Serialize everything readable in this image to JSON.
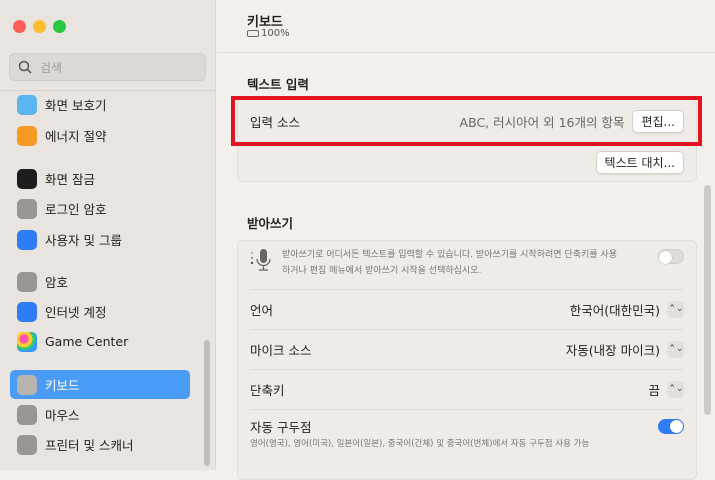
{
  "sidebar": {
    "search_placeholder": "검색",
    "items": [
      {
        "label": "화면 보호기",
        "icon": "screensaver-icon",
        "color": "#5bb5f0"
      },
      {
        "label": "에너지 절약",
        "icon": "lightbulb-icon",
        "color": "#f59a25"
      },
      {
        "label": "화면 잠금",
        "icon": "lock-screen-icon",
        "color": "#1c1c1c"
      },
      {
        "label": "로그인 암호",
        "icon": "lock-icon",
        "color": "#9a9592"
      },
      {
        "label": "사용자 및 그룹",
        "icon": "users-icon",
        "color": "#2f7cf6"
      },
      {
        "label": "암호",
        "icon": "key-icon",
        "color": "#9a9592"
      },
      {
        "label": "인터넷 계정",
        "icon": "at-icon",
        "color": "#2f7cf6"
      },
      {
        "label": "Game Center",
        "icon": "game-center-icon",
        "color": "#ffffff"
      },
      {
        "label": "키보드",
        "icon": "keyboard-icon",
        "color": "#b8b3af"
      },
      {
        "label": "마우스",
        "icon": "mouse-icon",
        "color": "#9a9592"
      },
      {
        "label": "프린터 및 스캐너",
        "icon": "printer-icon",
        "color": "#9a9592"
      }
    ],
    "selected": "키보드"
  },
  "header": {
    "title": "키보드",
    "battery": "100%"
  },
  "text_input": {
    "title": "텍스트 입력",
    "input_source_label": "입력 소스",
    "input_source_value": "ABC, 러시아어 외 16개의 항목",
    "edit_button": "편집...",
    "replace_button": "텍스트 대치..."
  },
  "dictation": {
    "title": "받아쓰기",
    "description": "받아쓰기로 어디서든 텍스트를 입력할 수 있습니다. 받아쓰기를 시작하려면 단축키를 사용하거나 편집 메뉴에서 받아쓰기 시작을 선택하십시오.",
    "enabled": false,
    "language_label": "언어",
    "language_value": "한국어(대한민국)",
    "mic_label": "마이크 소스",
    "mic_value": "자동(내장 마이크)",
    "shortcut_label": "단축키",
    "shortcut_value": "끔",
    "punct_label": "자동 구두점",
    "punct_desc": "영어(영국), 영어(미국), 일본어(일본), 중국어(간체) 및 중국어(번체)에서 자동 구두점 사용 가능",
    "punct_enabled": true
  }
}
